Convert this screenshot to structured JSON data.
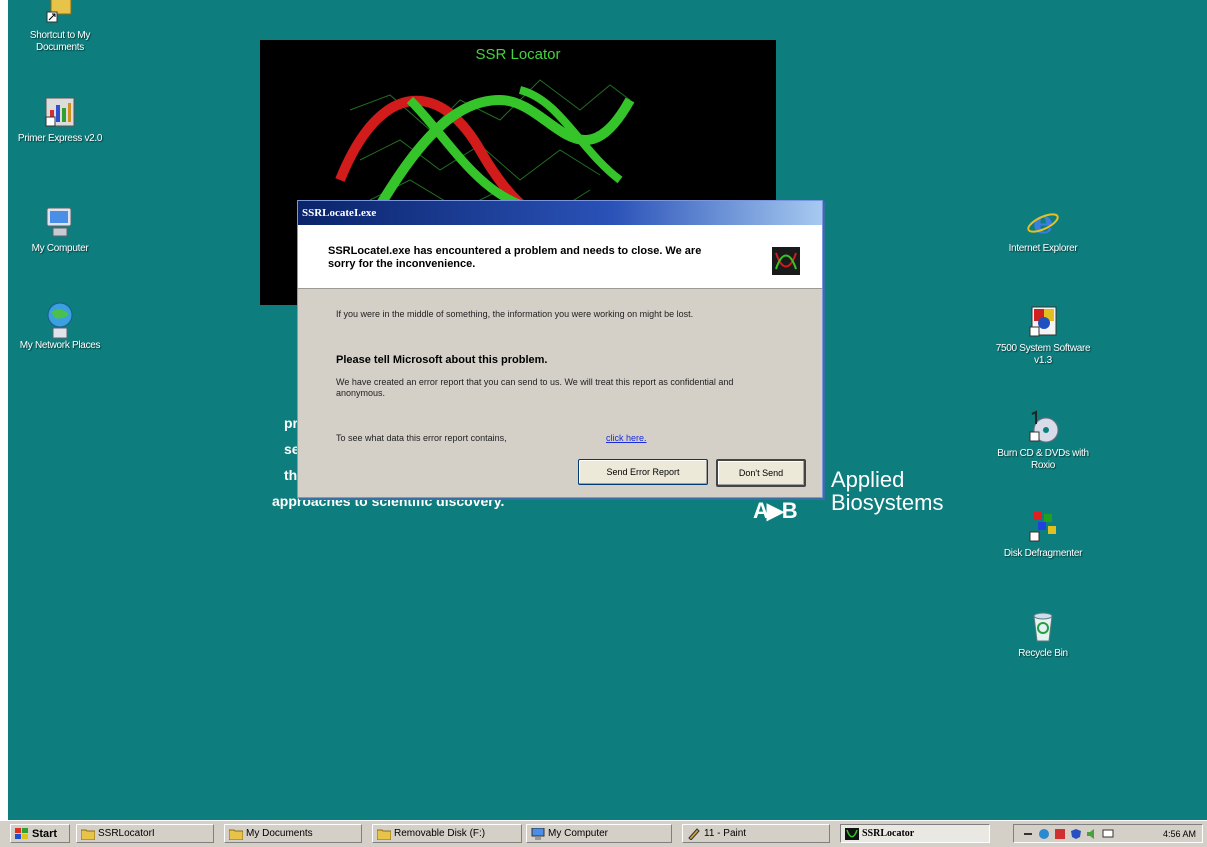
{
  "desktop_icons_left": [
    {
      "name": "documents-shortcut-icon",
      "label": "Shortcut to My Documents"
    },
    {
      "name": "primer-express-icon",
      "label": "Primer Express v2.0"
    },
    {
      "name": "my-computer-icon",
      "label": "My Computer"
    },
    {
      "name": "my-network-places-icon",
      "label": "My Network Places"
    }
  ],
  "desktop_icons_right": [
    {
      "name": "internet-explorer-icon",
      "label": "Internet Explorer"
    },
    {
      "name": "system-software-icon",
      "label": "7500 System Software v1.3"
    },
    {
      "name": "burn-cd-icon",
      "label": "Burn CD & DVDs with Roxio"
    },
    {
      "name": "disk-defragmenter-icon",
      "label": "Disk Defragmenter"
    },
    {
      "name": "recycle-bin-icon",
      "label": "Recycle Bin"
    }
  ],
  "splash": {
    "title": "SSR Locator",
    "tagline": [
      "pr",
      "ser",
      "th",
      "approaches to scientific discovery."
    ],
    "logo_mark": "A▶B",
    "logo_line1": "Applied",
    "logo_line2": "Biosystems"
  },
  "dialog": {
    "title": "SSRLocateI.exe",
    "headline": "SSRLocateI.exe has encountered a problem and needs to close.  We are sorry for the inconvenience.",
    "info": "If you were in the middle of something, the information you were working on might be lost.",
    "tell_heading": "Please tell Microsoft about this problem.",
    "tell_body": "We have created an error report that you can send to us.  We will treat this report as confidential and anonymous.",
    "see_text": "To see what data this error report contains,",
    "click_here": "click here.",
    "send_label": "Send Error Report",
    "dont_send_label": "Don't Send"
  },
  "taskbar": {
    "start": "start",
    "items": [
      {
        "label": "SSRLocatorI"
      },
      {
        "label": "My Documents"
      },
      {
        "label": "Removable Disk (F:)"
      },
      {
        "label": "My Computer"
      },
      {
        "label": "11 - Paint"
      },
      {
        "label": "SSRLocator"
      }
    ],
    "clock": "4:56 AM"
  },
  "colors": {
    "desktop": "#0e7d7d",
    "dna_green": "#35c42a",
    "dna_red": "#d21b1b"
  }
}
